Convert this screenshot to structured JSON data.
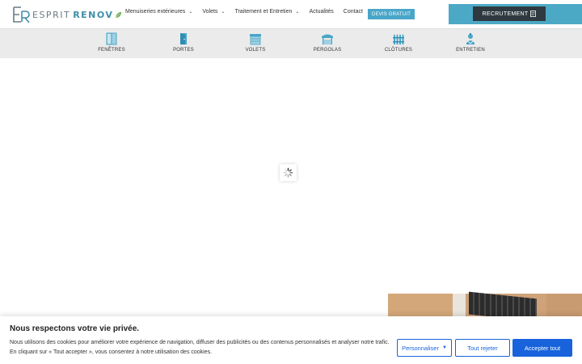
{
  "logo": {
    "word1": "ESPRIT",
    "word2": "RENOV"
  },
  "nav": {
    "items": [
      {
        "label": "Menuiseries extérieures",
        "dropdown": true
      },
      {
        "label": "Volets",
        "dropdown": true
      },
      {
        "label": "Traitement et Entretien",
        "dropdown": true
      },
      {
        "label": "Actualités",
        "dropdown": false
      },
      {
        "label": "Contact",
        "dropdown": false
      }
    ],
    "devis_label": "DEVIS GRATUIT",
    "recrutement_label": "RECRUTEMENT"
  },
  "categories": [
    {
      "label": "FENÊTRES",
      "icon": "window-icon"
    },
    {
      "label": "PORTES",
      "icon": "door-icon"
    },
    {
      "label": "VOLETS",
      "icon": "shutter-icon"
    },
    {
      "label": "PERGOLAS",
      "icon": "pergola-icon"
    },
    {
      "label": "CLÔTURES",
      "icon": "fence-icon"
    },
    {
      "label": "ENTRETIEN",
      "icon": "maintenance-icon"
    }
  ],
  "cookie": {
    "title": "Nous respectons votre vie privée.",
    "text": "Nous utilisons des cookies pour améliorer votre expérience de navigation, diffuser des publicités ou des contenus personnalisés et analyser notre trafic. En cliquant sur « Tout accepter », vous consentez à notre utilisation des cookies.",
    "customize_label": "Personnaliser",
    "reject_label": "Tout rejeter",
    "accept_label": "Accepter tout"
  },
  "colors": {
    "accent": "#4aa6c8",
    "dark": "#2f3a40",
    "cookie_primary": "#1863dc",
    "catbar_bg": "#ebebeb"
  }
}
